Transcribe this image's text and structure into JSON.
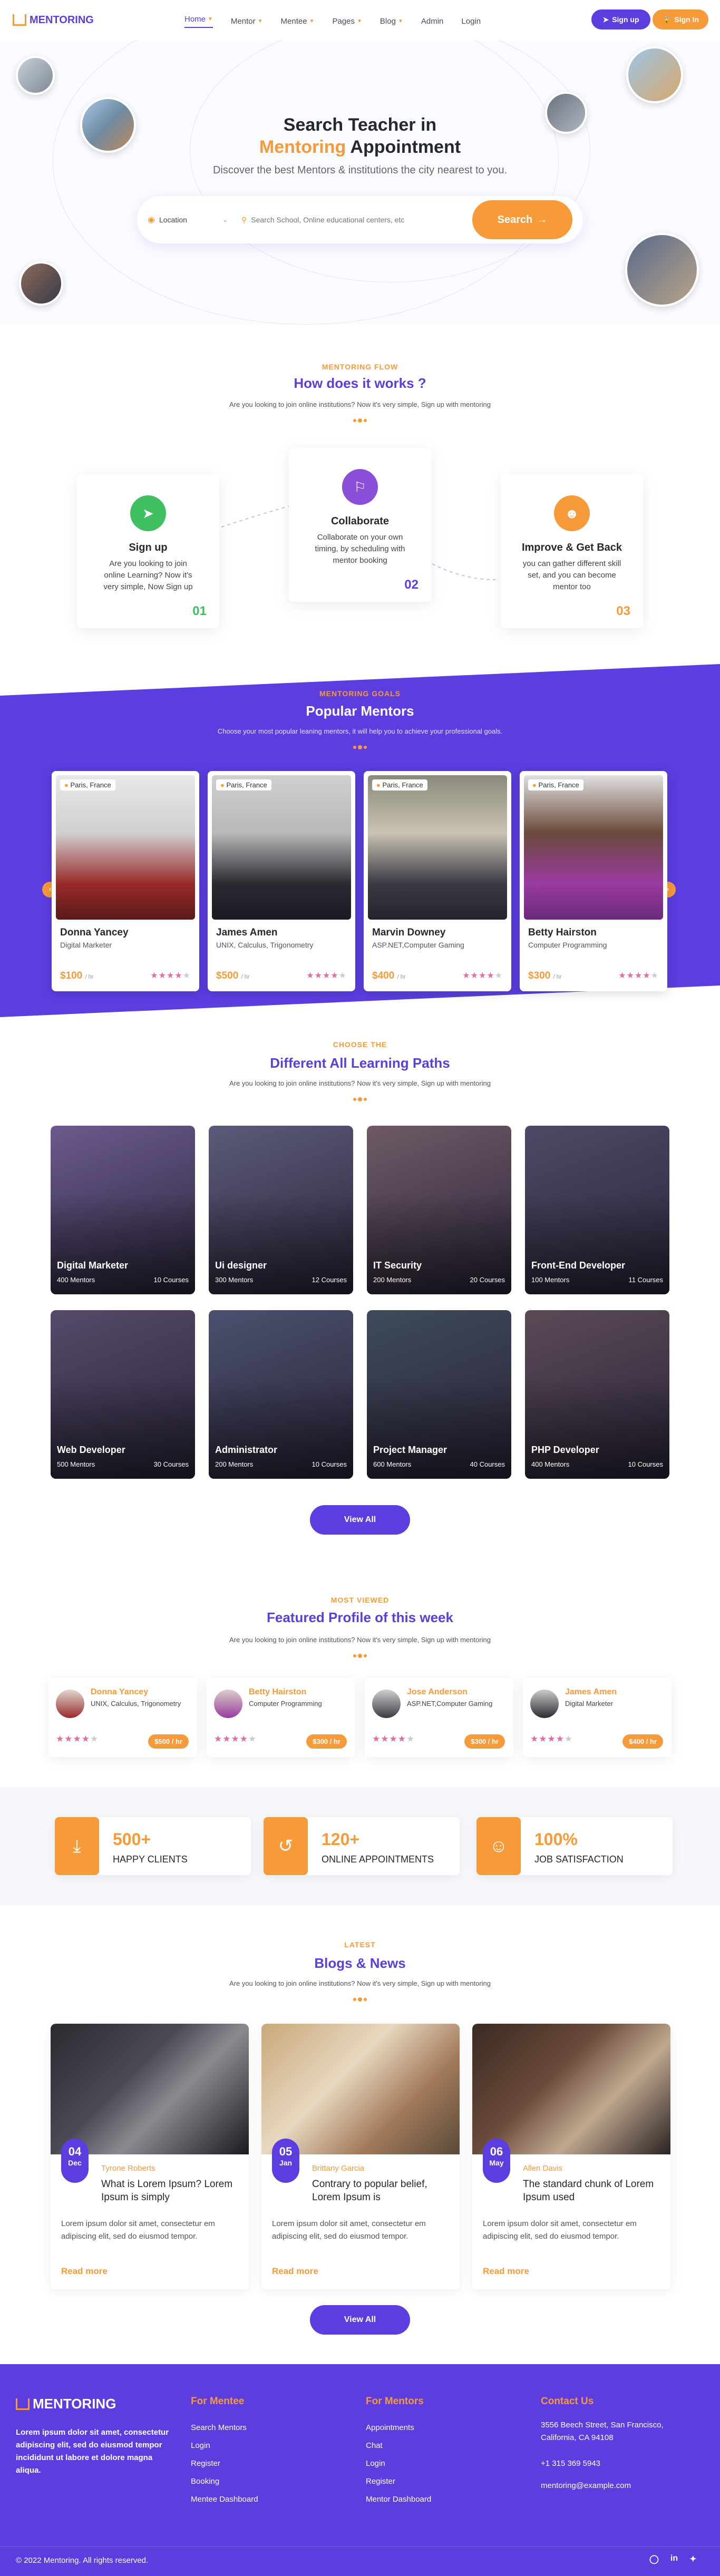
{
  "nav": {
    "logo_text": "MENTORING",
    "links": [
      {
        "label": "Home",
        "active": true,
        "dropdown": true
      },
      {
        "label": "Mentor",
        "active": false,
        "dropdown": true
      },
      {
        "label": "Mentee",
        "active": false,
        "dropdown": true
      },
      {
        "label": "Pages",
        "active": false,
        "dropdown": true
      },
      {
        "label": "Blog",
        "active": false,
        "dropdown": true
      },
      {
        "label": "Admin",
        "active": false,
        "dropdown": false
      },
      {
        "label": "Login",
        "active": false,
        "dropdown": false
      }
    ],
    "signup_label": "Sign up",
    "signin_label": "Sign In"
  },
  "hero": {
    "title_line1": "Search Teacher in",
    "title_highlight": "Mentoring",
    "title_rest": "Appointment",
    "subtitle": "Discover the best Mentors & institutions the city nearest to you.",
    "location_label": "Location",
    "search_placeholder": "Search School, Online educational centers, etc",
    "search_button": "Search"
  },
  "flow": {
    "label": "MENTORING FLOW",
    "title": "How does it works ?",
    "subtitle": "Are you looking to join online institutions? Now it's very simple, Sign up with mentoring",
    "cards": [
      {
        "title": "Sign up",
        "text": "Are you looking to join online Learning? Now it's very simple, Now Sign up",
        "num": "01"
      },
      {
        "title": "Collaborate",
        "text": "Collaborate on your own timing, by scheduling with mentor booking",
        "num": "02"
      },
      {
        "title": "Improve & Get Back",
        "text": "you can gather different skill set, and you can become mentor too",
        "num": "03"
      }
    ]
  },
  "mentors": {
    "label": "MENTORING GOALS",
    "title": "Popular Mentors",
    "subtitle": "Choose your most popular leaning mentors, it will help you to achieve your professional goals.",
    "cards": [
      {
        "location": "Paris, France",
        "name": "Donna Yancey",
        "skill": "Digital Marketer",
        "price": "$100",
        "per": "/ hr",
        "rating": 4
      },
      {
        "location": "Paris, France",
        "name": "James Amen",
        "skill": "UNIX, Calculus, Trigonometry",
        "price": "$500",
        "per": "/ hr",
        "rating": 4
      },
      {
        "location": "Paris, France",
        "name": "Marvin Downey",
        "skill": "ASP.NET,Computer Gaming",
        "price": "$400",
        "per": "/ hr",
        "rating": 4
      },
      {
        "location": "Paris, France",
        "name": "Betty Hairston",
        "skill": "Computer Programming",
        "price": "$300",
        "per": "/ hr",
        "rating": 4
      }
    ]
  },
  "paths": {
    "label": "CHOOSE THE",
    "title": "Different All Learning Paths",
    "subtitle": "Are you looking to join online institutions? Now it's very simple, Sign up with mentoring",
    "cards": [
      {
        "title": "Digital Marketer",
        "mentors": "400 Mentors",
        "courses": "10 Courses",
        "tint": "#6b5a8e"
      },
      {
        "title": "Ui designer",
        "mentors": "300 Mentors",
        "courses": "12 Courses",
        "tint": "#5a5a7a"
      },
      {
        "title": "IT Security",
        "mentors": "200 Mentors",
        "courses": "20 Courses",
        "tint": "#6e5a66"
      },
      {
        "title": "Front-End Developer",
        "mentors": "100 Mentors",
        "courses": "11 Courses",
        "tint": "#4e4a66"
      },
      {
        "title": "Web Developer",
        "mentors": "500 Mentors",
        "courses": "30 Courses",
        "tint": "#554a6a"
      },
      {
        "title": "Administrator",
        "mentors": "200 Mentors",
        "courses": "10 Courses",
        "tint": "#4a506e"
      },
      {
        "title": "Project Manager",
        "mentors": "600 Mentors",
        "courses": "40 Courses",
        "tint": "#3e4a5a"
      },
      {
        "title": "PHP Developer",
        "mentors": "400 Mentors",
        "courses": "10 Courses",
        "tint": "#5a4a56"
      }
    ],
    "view_all": "View All"
  },
  "featured": {
    "label": "MOST VIEWED",
    "title": "Featured Profile of this week",
    "subtitle": "Are you looking to join online institutions? Now it's very simple, Sign up with mentoring",
    "cards": [
      {
        "name": "Donna Yancey",
        "skill": "UNIX, Calculus, Trigonometry",
        "price": "$500 / hr",
        "rating": 4
      },
      {
        "name": "Betty Hairston",
        "skill": "Computer Programming",
        "price": "$300 / hr",
        "rating": 4
      },
      {
        "name": "Jose Anderson",
        "skill": "ASP.NET,Computer Gaming",
        "price": "$300 / hr",
        "rating": 4
      },
      {
        "name": "James Amen",
        "skill": "Digital Marketer",
        "price": "$400 / hr",
        "rating": 4
      }
    ]
  },
  "stats": [
    {
      "num": "500+",
      "label": "HAPPY CLIENTS"
    },
    {
      "num": "120+",
      "label": "ONLINE APPOINTMENTS"
    },
    {
      "num": "100%",
      "label": "JOB SATISFACTION"
    }
  ],
  "blog": {
    "label": "LATEST",
    "title": "Blogs & News",
    "subtitle": "Are you looking to join online institutions? Now it's very simple, Sign up with mentoring",
    "posts": [
      {
        "day": "04",
        "month": "Dec",
        "author": "Tyrone Roberts",
        "title": "What is Lorem Ipsum? Lorem Ipsum is simply",
        "text": "Lorem ipsum dolor sit amet, consectetur em adipiscing elit, sed do eiusmod tempor.",
        "more": "Read more"
      },
      {
        "day": "05",
        "month": "Jan",
        "author": "Brittany Garcia",
        "title": "Contrary to popular belief, Lorem Ipsum is",
        "text": "Lorem ipsum dolor sit amet, consectetur em adipiscing elit, sed do eiusmod tempor.",
        "more": "Read more"
      },
      {
        "day": "06",
        "month": "May",
        "author": "Allen Davis",
        "title": "The standard chunk of Lorem Ipsum used",
        "text": "Lorem ipsum dolor sit amet, consectetur em adipiscing elit, sed do eiusmod tempor.",
        "more": "Read more"
      }
    ],
    "view_all": "View All"
  },
  "footer": {
    "logo_text": "MENTORING",
    "about": "Lorem ipsum dolor sit amet, consectetur adipiscing elit, sed do eiusmod tempor incididunt ut labore et dolore magna aliqua.",
    "mentee_title": "For Mentee",
    "mentee_links": [
      "Search Mentors",
      "Login",
      "Register",
      "Booking",
      "Mentee Dashboard"
    ],
    "mentors_title": "For Mentors",
    "mentors_links": [
      "Appointments",
      "Chat",
      "Login",
      "Register",
      "Mentor Dashboard"
    ],
    "contact_title": "Contact Us",
    "address": "3556 Beech Street, San Francisco, California, CA 94108",
    "phone": "+1 315 369 5943",
    "email": "mentoring@example.com",
    "copyright": "© 2022 Mentoring. All rights reserved."
  },
  "colors": {
    "primary": "#5b3de0",
    "accent": "#f79a3a",
    "star": "#e86aa0"
  }
}
